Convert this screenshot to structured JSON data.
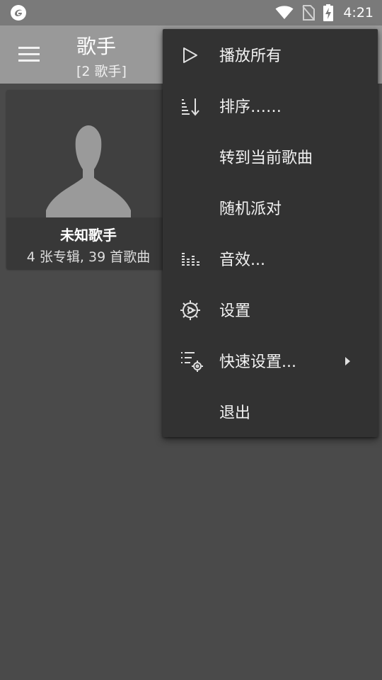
{
  "status_bar": {
    "time": "4:21",
    "icons": [
      "app-notification-icon",
      "wifi-icon",
      "no-sim-icon",
      "battery-charging-icon"
    ]
  },
  "app_bar": {
    "title": "歌手",
    "subtitle": "[2 歌手]"
  },
  "artist_card": {
    "name": "未知歌手",
    "meta": "4 张专辑, 39 首歌曲"
  },
  "overflow_menu": {
    "items": [
      {
        "label": "播放所有",
        "icon": "play-icon"
      },
      {
        "label": "排序……",
        "icon": "sort-icon"
      },
      {
        "label": "转到当前歌曲",
        "icon": ""
      },
      {
        "label": "随机派对",
        "icon": ""
      },
      {
        "label": "音效...",
        "icon": "equalizer-icon"
      },
      {
        "label": "设置",
        "icon": "settings-icon"
      },
      {
        "label": "快速设置...",
        "icon": "quick-settings-icon",
        "has_submenu": true
      },
      {
        "label": "退出",
        "icon": ""
      }
    ]
  },
  "colors": {
    "background": "#4a4a4a",
    "status_bar": "#7a7a7a",
    "app_bar": "#999999",
    "menu_background": "#323232",
    "text_primary": "#f2f2f2"
  }
}
